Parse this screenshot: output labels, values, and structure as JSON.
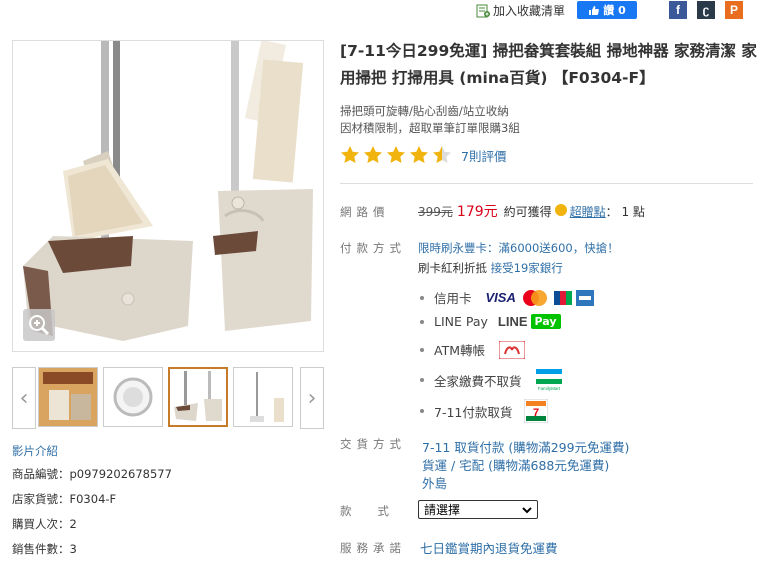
{
  "header": {
    "favorite_label": "加入收藏清單",
    "like_label": "讚 0",
    "icons": [
      "facebook-icon",
      "share-icon",
      "plurk-icon"
    ]
  },
  "product": {
    "title": "[7-11今日299免運] 掃把畚箕套裝組 掃地神器 家務清潔 家用掃把 打掃用具 (mina百貨) 【F0304-F】",
    "subtitle_line1": "掃把頭可旋轉/貼心刮齒/站立收納",
    "subtitle_line2": "因材積限制，超取單筆訂單限購3組",
    "rating": 4.5,
    "review_text": "7則評價"
  },
  "left": {
    "video_link": "影片介紹",
    "product_no": "商品編號：p0979202678577",
    "shop_no": "店家貨號：F0304-F",
    "buyers": "購買人次：2",
    "sold": "銷售件數：3"
  },
  "price": {
    "label": "網路價",
    "old_price": "399元",
    "new_price": "179元",
    "earn_text": "約可獲得",
    "bonus_link": "超贈點",
    "bonus_suffix": "： 1 點"
  },
  "payment": {
    "label": "付款方式",
    "promo1": "限時刷永豐卡：滿6000送600，快搶！",
    "promo2_prefix": "刷卡紅利折抵 ",
    "promo2_link": "接受19家銀行",
    "methods": [
      "信用卡",
      "LINE Pay",
      "ATM轉帳",
      "全家繳費不取貨",
      "7-11付款取貨"
    ],
    "logos": {
      "visa": "VISA",
      "line": "LINE",
      "pay": "Pay",
      "familymart": "FamilyMart"
    }
  },
  "shipping": {
    "label": "交貨方式",
    "options": [
      "7-11 取貨付款 (購物滿299元免運費)",
      "貨運 / 宅配 (購物滿688元免運費)",
      "外島"
    ]
  },
  "variant": {
    "label": "款式",
    "selected": "請選擇"
  },
  "service": {
    "label": "服務承諾",
    "text": "七日鑑賞期內退貨免運費"
  },
  "colors": {
    "link": "#2f6fa7",
    "price": "#d8001a",
    "star": "#f1b30e"
  }
}
